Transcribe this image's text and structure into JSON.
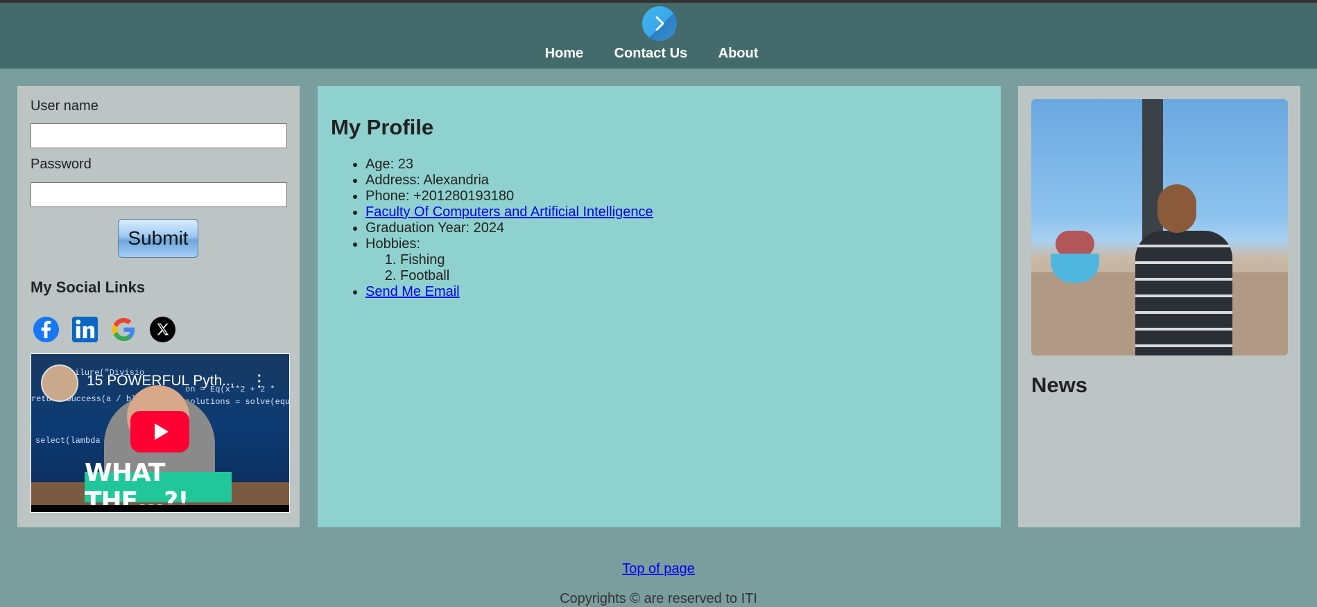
{
  "header": {
    "logo_icon": "chevron-right-icon",
    "nav": [
      "Home",
      "Contact Us",
      "About"
    ]
  },
  "login": {
    "username_label": "User name",
    "username_value": "",
    "password_label": "Password",
    "password_value": "",
    "submit_label": "Submit"
  },
  "social": {
    "title": "My Social Links",
    "icons": [
      "facebook-icon",
      "linkedin-icon",
      "google-icon",
      "x-icon"
    ]
  },
  "video": {
    "title": "15 POWERFUL Pyth...",
    "thumbnail_text": "WHAT THE...?!",
    "code_lines": [
      "return Success(a / b)",
      "Failure(\"Divisio",
      "solutions = solve(equatio",
      "on = Eq(x**2 + 2 *",
      "select(lambda x: x"
    ]
  },
  "profile": {
    "heading": "My Profile",
    "age": "Age: 23",
    "address": "Address: Alexandria",
    "phone": "Phone: +201280193180",
    "faculty_link": "Faculty Of Computers and Artificial Intelligence",
    "graduation": "Graduation Year: 2024",
    "hobbies_label": "Hobbies:",
    "hobbies": [
      "Fishing",
      "Football"
    ],
    "email_link": "Send Me Email"
  },
  "sidebar_right": {
    "news_heading": "News"
  },
  "footer": {
    "top_link": "Top of page",
    "copyright": "Copyrights © are reserved to ITI"
  },
  "colors": {
    "header_bg": "#436b6b",
    "page_bg": "#7a9e9e",
    "side_panel_bg": "#bcc4c4",
    "center_panel_bg": "#8fd1cf",
    "link": "#0000ee"
  }
}
